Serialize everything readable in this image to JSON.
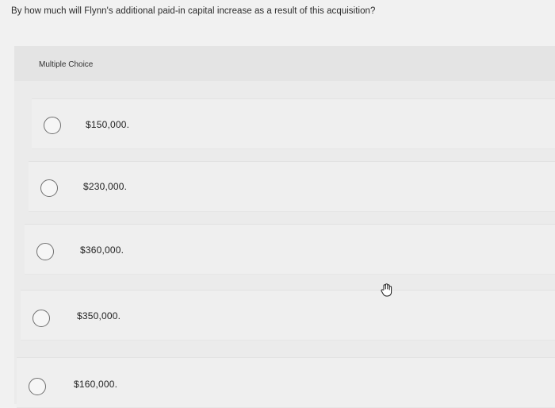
{
  "question": {
    "text": "By how much will Flynn's additional paid-in capital increase as a result of this acquisition?"
  },
  "choices": {
    "header": "Multiple Choice",
    "options": [
      {
        "label": "$150,000.",
        "selected": false
      },
      {
        "label": "$230,000.",
        "selected": false
      },
      {
        "label": "$360,000.",
        "selected": false
      },
      {
        "label": "$350,000.",
        "selected": false
      },
      {
        "label": "$160,000.",
        "selected": false
      }
    ]
  },
  "icons": {
    "pointer": "hand-pointer-icon",
    "radio": "radio-unselected-icon"
  },
  "colors": {
    "background": "#f1f1f1",
    "panel": "#ebebeb",
    "radio_border": "#6e6e6e"
  }
}
